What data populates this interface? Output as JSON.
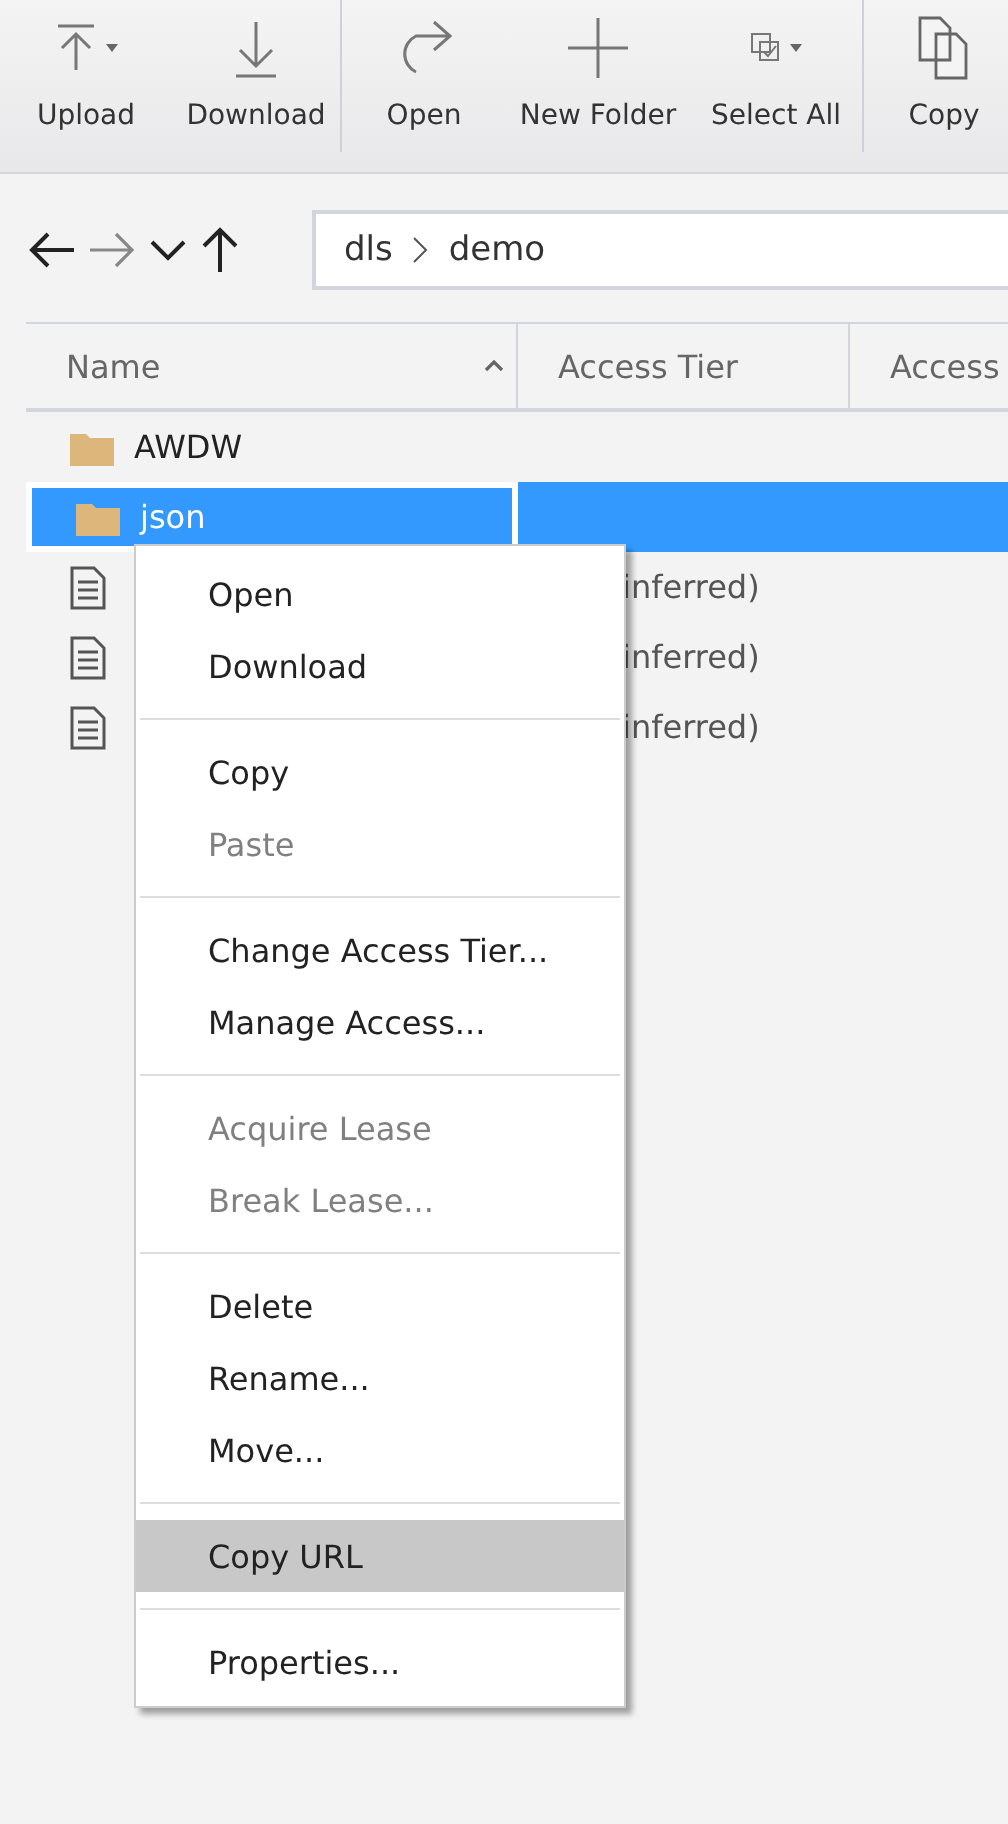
{
  "toolbar": {
    "groups": [
      {
        "items": [
          {
            "label": "Upload",
            "dropdown": true
          },
          {
            "label": "Download",
            "dropdown": false
          }
        ]
      },
      {
        "items": [
          {
            "label": "Open",
            "dropdown": false
          },
          {
            "label": "New Folder",
            "dropdown": false
          },
          {
            "label": "Select All",
            "dropdown": true
          }
        ]
      },
      {
        "items": [
          {
            "label": "Copy",
            "dropdown": false
          }
        ]
      }
    ]
  },
  "navigation": {
    "path": [
      "dls",
      "demo"
    ]
  },
  "table": {
    "columns": [
      {
        "label": "Name",
        "sorted": true
      },
      {
        "label": "Access Tier",
        "sorted": false
      },
      {
        "label": "Access",
        "sorted": false
      }
    ],
    "rows": [
      {
        "kind": "folder",
        "name": "AWDW",
        "access_tier": "",
        "selected": false
      },
      {
        "kind": "folder",
        "name": "json",
        "access_tier": "",
        "selected": true
      },
      {
        "kind": "file",
        "name": "",
        "access_tier": "inferred)",
        "selected": false
      },
      {
        "kind": "file",
        "name": "",
        "access_tier": "inferred)",
        "selected": false
      },
      {
        "kind": "file",
        "name": "",
        "access_tier": "inferred)",
        "selected": false
      }
    ]
  },
  "context_menu": {
    "groups": [
      {
        "items": [
          {
            "label": "Open",
            "disabled": false,
            "selected": false
          },
          {
            "label": "Download",
            "disabled": false,
            "selected": false
          }
        ]
      },
      {
        "items": [
          {
            "label": "Copy",
            "disabled": false,
            "selected": false
          },
          {
            "label": "Paste",
            "disabled": true,
            "selected": false
          }
        ]
      },
      {
        "items": [
          {
            "label": "Change Access Tier...",
            "disabled": false,
            "selected": false
          },
          {
            "label": "Manage Access...",
            "disabled": false,
            "selected": false
          }
        ]
      },
      {
        "items": [
          {
            "label": "Acquire Lease",
            "disabled": true,
            "selected": false
          },
          {
            "label": "Break Lease...",
            "disabled": true,
            "selected": false
          }
        ]
      },
      {
        "items": [
          {
            "label": "Delete",
            "disabled": false,
            "selected": false
          },
          {
            "label": "Rename...",
            "disabled": false,
            "selected": false
          },
          {
            "label": "Move...",
            "disabled": false,
            "selected": false
          }
        ]
      },
      {
        "items": [
          {
            "label": "Copy URL",
            "disabled": false,
            "selected": true
          }
        ]
      },
      {
        "items": [
          {
            "label": "Properties...",
            "disabled": false,
            "selected": false
          }
        ]
      }
    ]
  }
}
